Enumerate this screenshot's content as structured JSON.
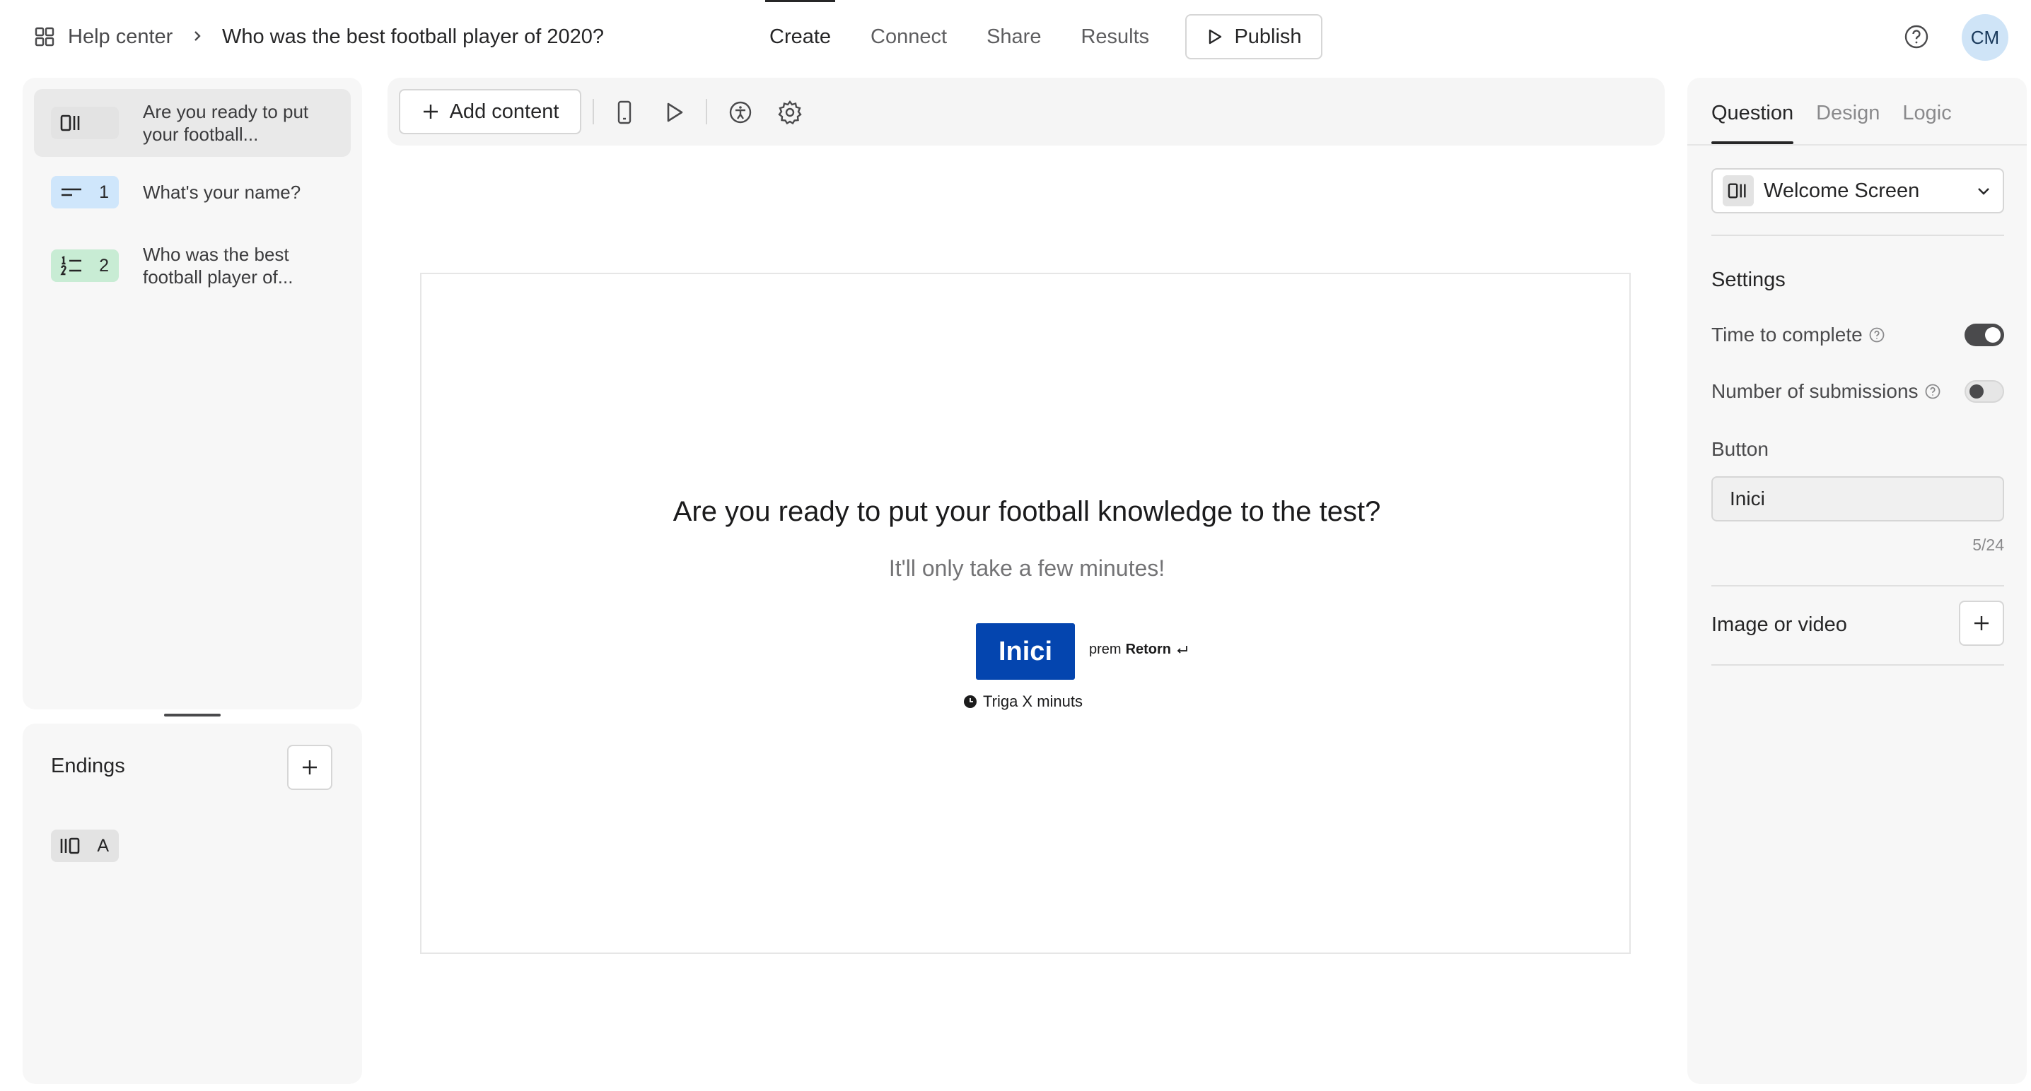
{
  "header": {
    "breadcrumb_root": "Help center",
    "form_title": "Who was the best football player of 2020?",
    "tabs": [
      {
        "label": "Create"
      },
      {
        "label": "Connect"
      },
      {
        "label": "Share"
      },
      {
        "label": "Results"
      }
    ],
    "publish_label": "Publish",
    "avatar_initials": "CM"
  },
  "questions": [
    {
      "badge_num": "",
      "label": "Are you ready to put your football...",
      "badge_color": "#e3e3e3",
      "icon": "welcome-screen-icon"
    },
    {
      "badge_num": "1",
      "label": "What's your name?",
      "badge_color": "#cfe6fb",
      "icon": "short-text-icon"
    },
    {
      "badge_num": "2",
      "label": "Who was the best football player of...",
      "badge_color": "#c8ecd4",
      "icon": "numbered-list-icon"
    }
  ],
  "endings": {
    "title": "Endings",
    "items": [
      {
        "badge_num": "A",
        "icon": "ending-screen-icon"
      }
    ]
  },
  "toolbar": {
    "add_content_label": "Add content"
  },
  "canvas": {
    "title": "Are you ready to put your football knowledge to the test?",
    "subtitle": "It'll only take a few minutes!",
    "button_label": "Inici",
    "press_prefix": "prem",
    "press_key": "Retorn",
    "time_text": "Triga X minuts",
    "accent_color": "#0445af"
  },
  "right_panel": {
    "tabs": [
      {
        "label": "Question"
      },
      {
        "label": "Design"
      },
      {
        "label": "Logic"
      }
    ],
    "type_select": "Welcome Screen",
    "settings_title": "Settings",
    "settings": [
      {
        "label": "Time to complete",
        "on": true
      },
      {
        "label": "Number of submissions",
        "on": false
      }
    ],
    "button_label": "Button",
    "button_value": "Inici",
    "char_count": "5/24",
    "image_video_label": "Image or video"
  }
}
